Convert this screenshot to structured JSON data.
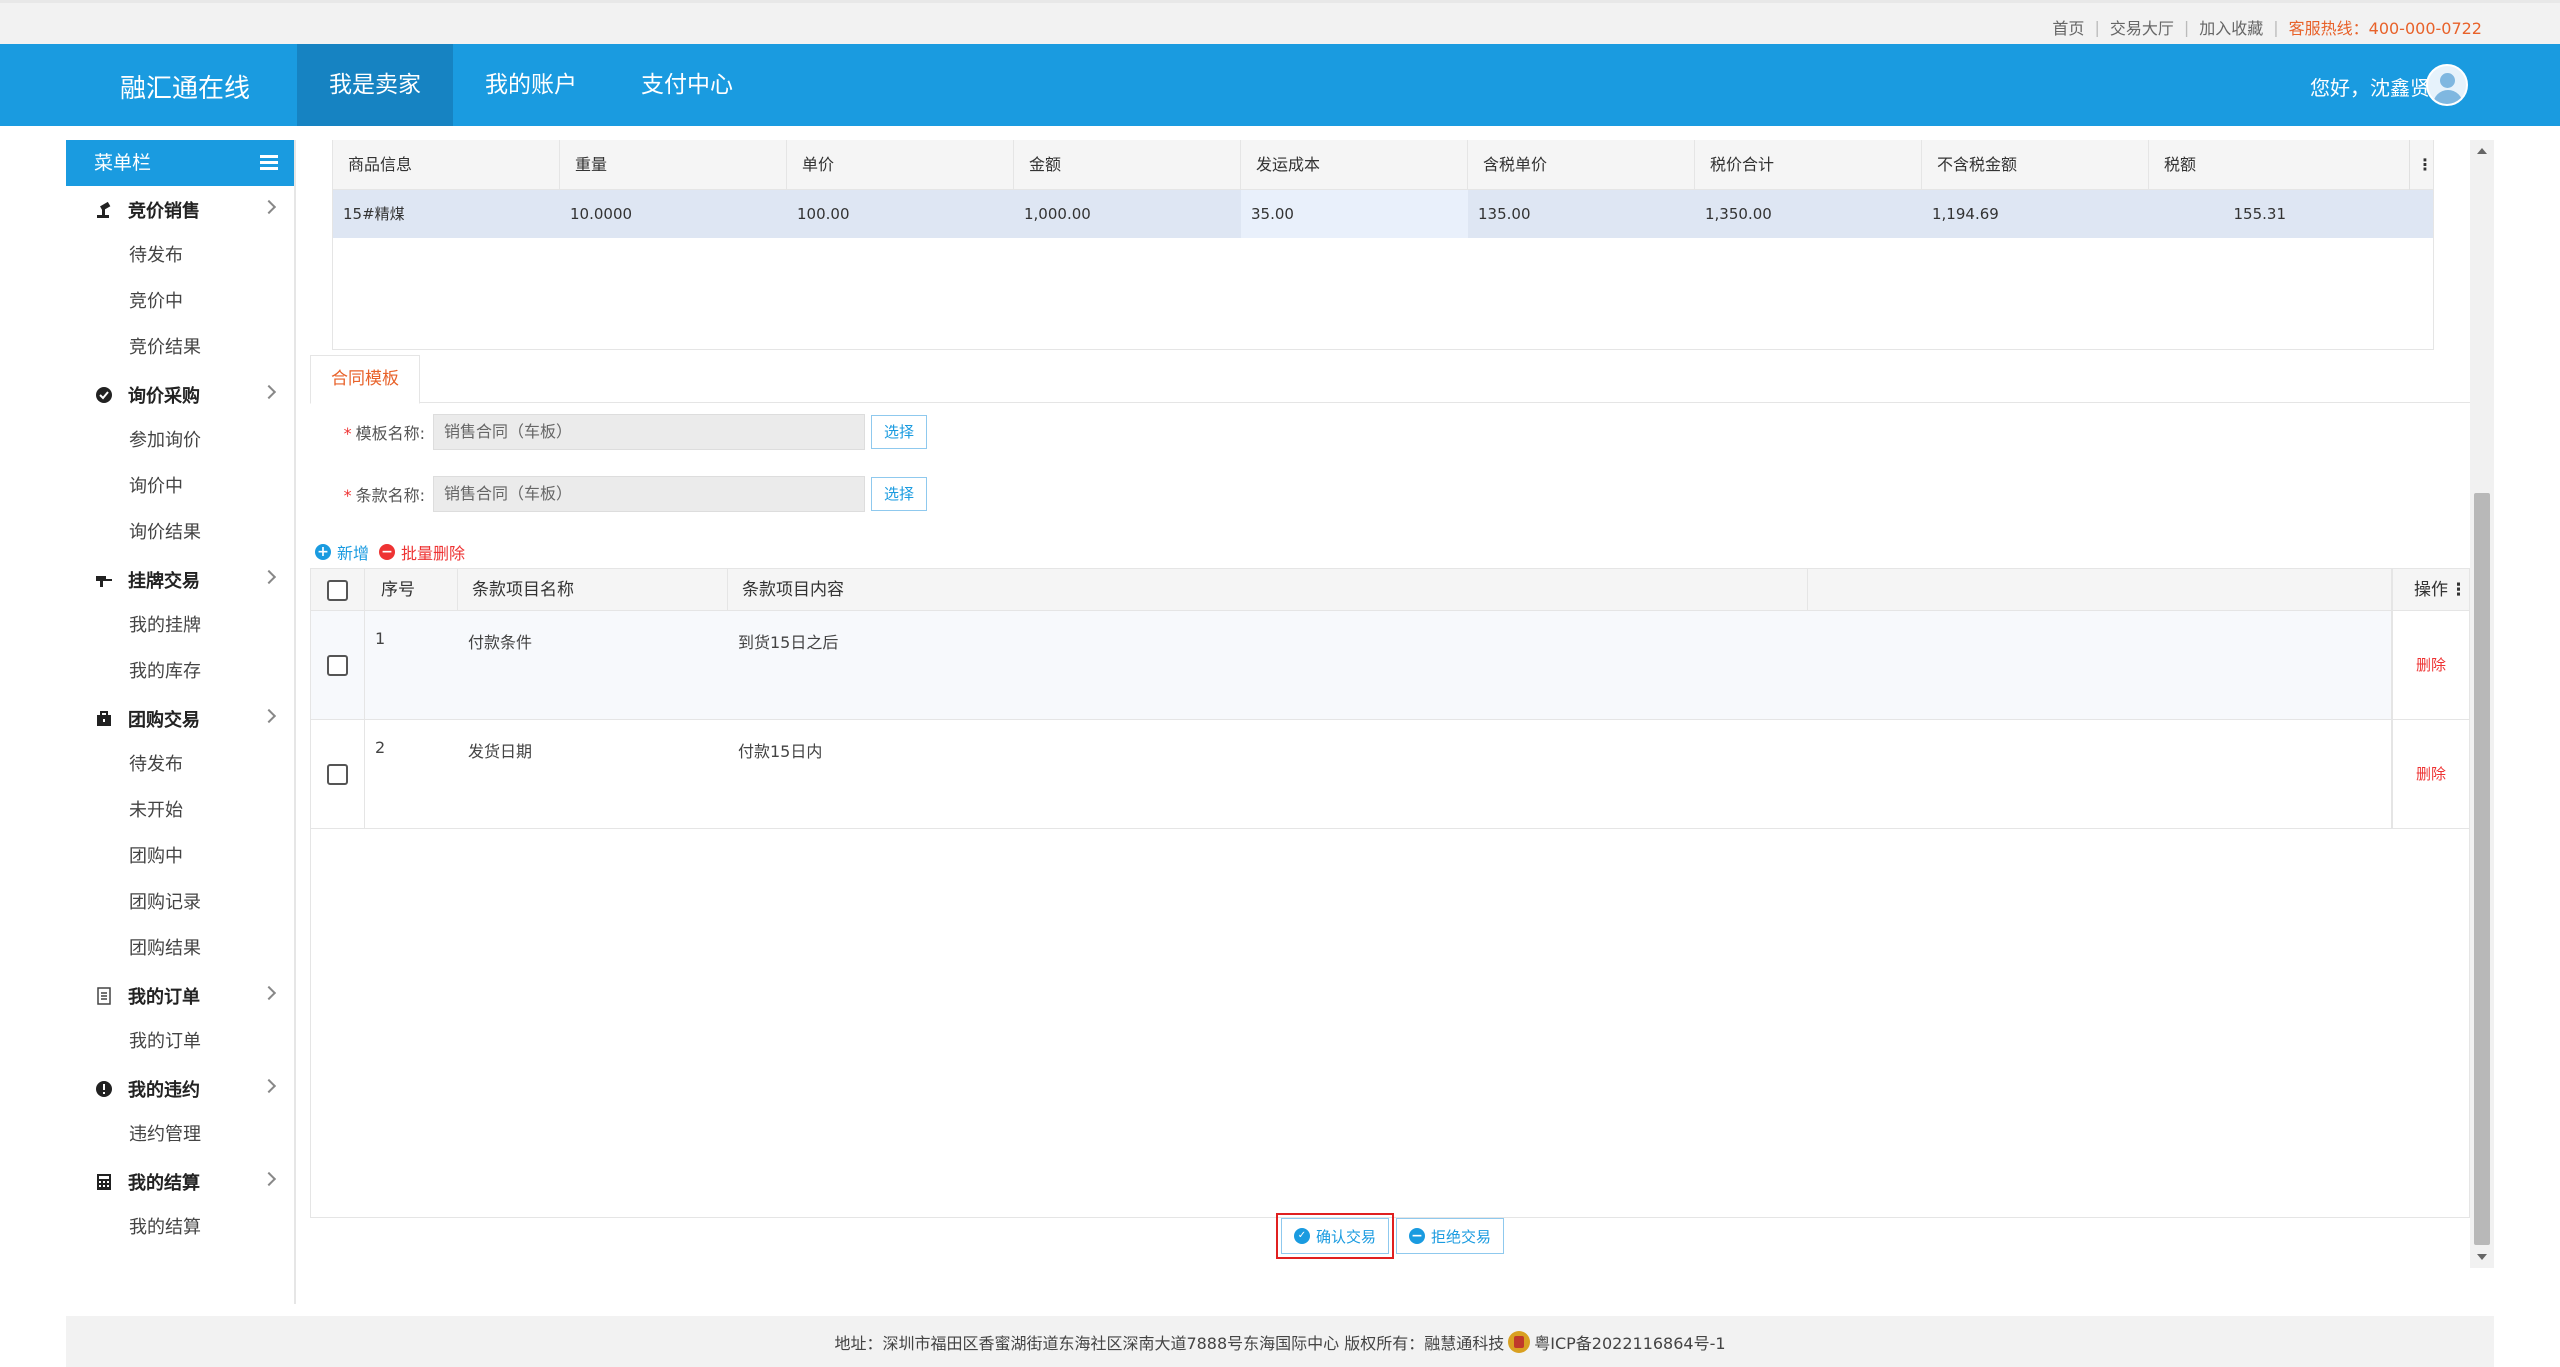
{
  "topbar": {
    "links": [
      "首页",
      "交易大厅",
      "加入收藏"
    ],
    "hotline": "客服热线：400-000-0722"
  },
  "header": {
    "brand": "融汇通在线",
    "nav": [
      "我是卖家",
      "我的账户",
      "支付中心"
    ],
    "greeting": "您好，沈鑫贤"
  },
  "sidebar": {
    "title": "菜单栏",
    "groups": [
      {
        "label": "竞价销售",
        "icon": "gavel-icon",
        "items": [
          "待发布",
          "竞价中",
          "竞价结果"
        ]
      },
      {
        "label": "询价采购",
        "icon": "check-circle-icon",
        "items": [
          "参加询价",
          "询价中",
          "询价结果"
        ]
      },
      {
        "label": "挂牌交易",
        "icon": "hammer-icon",
        "items": [
          "我的挂牌",
          "我的库存"
        ]
      },
      {
        "label": "团购交易",
        "icon": "briefcase-icon",
        "items": [
          "待发布",
          "未开始",
          "团购中",
          "团购记录",
          "团购结果"
        ]
      },
      {
        "label": "我的订单",
        "icon": "document-icon",
        "items": [
          "我的订单"
        ]
      },
      {
        "label": "我的违约",
        "icon": "exclamation-icon",
        "items": [
          "违约管理"
        ]
      },
      {
        "label": "我的结算",
        "icon": "calculator-icon",
        "items": [
          "我的结算"
        ]
      }
    ]
  },
  "goods_table": {
    "headers": [
      "商品信息",
      "重量",
      "单价",
      "金额",
      "发运成本",
      "含税单价",
      "税价合计",
      "不含税金额",
      "税额"
    ],
    "rows": [
      [
        "15#精煤",
        "10.0000",
        "100.00",
        "1,000.00",
        "35.00",
        "135.00",
        "1,350.00",
        "1,194.69",
        "155.31"
      ]
    ]
  },
  "contract": {
    "tab": "合同模板",
    "template_label": "模板名称:",
    "template_value": "销售合同（车板）",
    "clause_label": "条款名称:",
    "clause_value": "销售合同（车板）",
    "select_btn": "选择",
    "add": "新增",
    "batch_delete": "批量删除"
  },
  "clause_table": {
    "headers": [
      "序号",
      "条款项目名称",
      "条款项目内容"
    ],
    "op_header": "操作",
    "rows": [
      {
        "no": "1",
        "name": "付款条件",
        "content": "到货15日之后",
        "op": "删除"
      },
      {
        "no": "2",
        "name": "发货日期",
        "content": "付款15日内",
        "op": "删除"
      }
    ]
  },
  "buttons": {
    "confirm": "确认交易",
    "reject": "拒绝交易"
  },
  "footer": {
    "text": "地址：深圳市福田区香蜜湖街道东海社区深南大道7888号东海国际中心   版权所有：融慧通科技",
    "icp": "粤ICP备2022116864号-1"
  },
  "colors": {
    "primary": "#1a9be0",
    "accent": "#e8622a",
    "danger": "#e33333",
    "highlight_border": "#e02020"
  }
}
